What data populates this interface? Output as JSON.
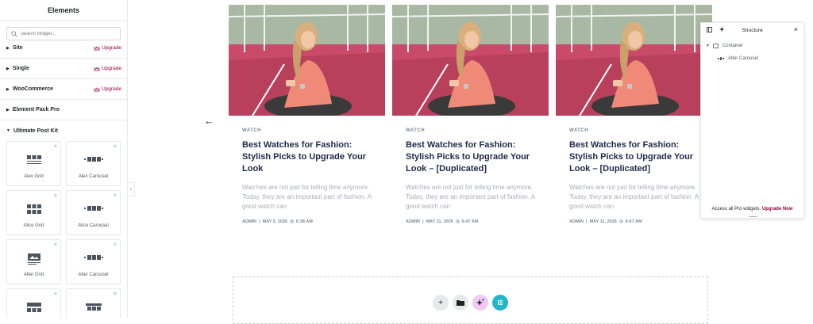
{
  "panel": {
    "title": "Elements",
    "search_placeholder": "Search Widget...",
    "categories": [
      {
        "name": "Site",
        "upgrade": "Upgrade"
      },
      {
        "name": "Single",
        "upgrade": "Upgrade"
      },
      {
        "name": "WooCommerce",
        "upgrade": "Upgrade"
      },
      {
        "name": "Element Pack Pro"
      },
      {
        "name": "Ultimate Post Kit"
      }
    ],
    "widgets": [
      {
        "label": "Alex Grid",
        "icon": "grid-widget-icon"
      },
      {
        "label": "Alex Carousel",
        "icon": "carousel-widget-icon"
      },
      {
        "label": "Alice Grid",
        "icon": "grid-widget-icon"
      },
      {
        "label": "Alice Carousel",
        "icon": "carousel-widget-icon"
      },
      {
        "label": "Alter Grid",
        "icon": "image-grid-widget-icon"
      },
      {
        "label": "Alter Carousel",
        "icon": "carousel-widget-icon"
      },
      {
        "label": "",
        "icon": "grid-widget-icon"
      },
      {
        "label": "",
        "icon": "carousel-widget-icon"
      }
    ]
  },
  "cards": [
    {
      "category": "WATCH",
      "title": "Best Watches for Fashion: Stylish Picks to Upgrade Your Look",
      "excerpt": "Watches are not just for telling time anymore. Today, they are an important part of fashion. A good watch can",
      "author": "ADMIN",
      "date": "MAY 5, 2026",
      "time": "6:38 AM"
    },
    {
      "category": "WATCH",
      "title": "Best Watches for Fashion: Stylish Picks to Upgrade Your Look – [Duplicated]",
      "excerpt": "Watches are not just for telling time anymore. Today, they are an important part of fashion. A good watch can",
      "author": "ADMIN",
      "date": "MAY 11, 2026",
      "time": "6:47 AM"
    },
    {
      "category": "WATCH",
      "title": "Best Watches for Fashion: Stylish Picks to Upgrade Your Look – [Duplicated]",
      "excerpt": "Watches are not just for telling time anymore. Today, they are an important part of fashion. A good watch can",
      "author": "ADMIN",
      "date": "MAY 11, 2026",
      "time": "6:47 AM"
    }
  ],
  "structure": {
    "title": "Structure",
    "tree": [
      {
        "label": "Container",
        "icon": "container-icon"
      },
      {
        "label": "Alter Carousel",
        "icon": "carousel-widget-icon"
      }
    ],
    "footer_text": "Access all Pro widgets.",
    "footer_link": "Upgrade Now"
  },
  "dropzone_buttons": [
    {
      "name": "add-section-button",
      "glyph": "+"
    },
    {
      "name": "template-library-button",
      "glyph": "folder"
    },
    {
      "name": "ai-button",
      "glyph": "sparkle"
    },
    {
      "name": "elementor-kit-button",
      "glyph": "E"
    }
  ],
  "colors": {
    "accent": "#93003f",
    "ai_pink": "#f0c8f5",
    "kit_teal": "#1fb8c8",
    "title_navy": "#1e2a4a"
  }
}
